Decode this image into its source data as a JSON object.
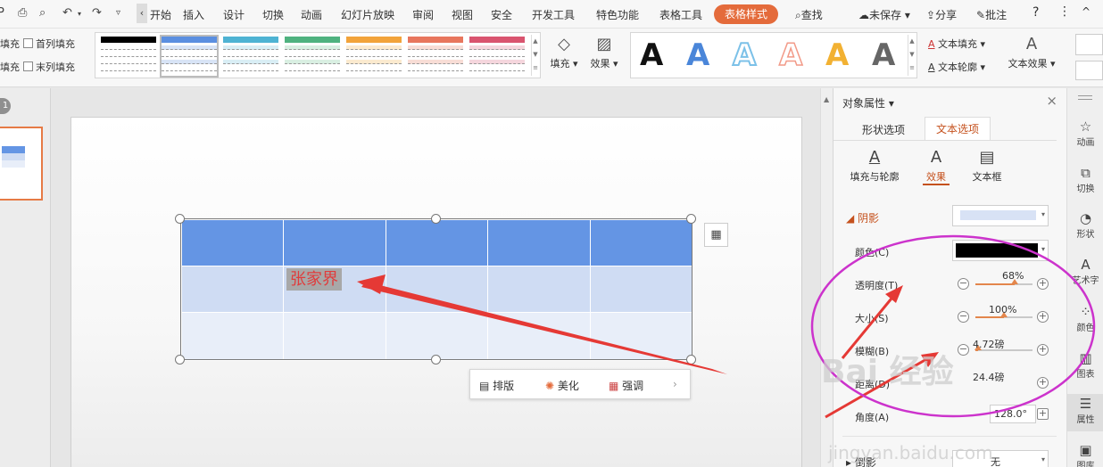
{
  "menubar": {
    "icons": [
      "print-icon",
      "print-preview-icon",
      "undo-icon",
      "redo-icon",
      "more-icon"
    ],
    "tabs": [
      "开始",
      "插入",
      "设计",
      "切换",
      "动画",
      "幻灯片放映",
      "审阅",
      "视图",
      "安全",
      "开发工具",
      "特色功能",
      "表格工具",
      "表格样式"
    ],
    "active_tab": "表格样式",
    "search": "查找",
    "unsaved": "未保存",
    "share": "分享",
    "comment": "批注",
    "help": "?",
    "ribbon_collapse": "^"
  },
  "ribbon": {
    "options": [
      "填充",
      "首列填充",
      "填充",
      "末列填充"
    ],
    "fill_label": "填充",
    "effect_label": "效果",
    "text_fill": "文本填充",
    "text_outline": "文本轮廓",
    "text_effect": "文本效果",
    "wordart_letter": "A",
    "table_style_colors": [
      "#000000",
      "#5b8fe0",
      "#4eb3d3",
      "#4fb27f",
      "#f2a33a",
      "#e8765d",
      "#d9546f"
    ],
    "wordart_colors": [
      "#111111",
      "#4a86d9",
      "#7cc1e8",
      "#f29a88",
      "#f2b132",
      "#666666"
    ]
  },
  "left_pane": {
    "slide_number": "1"
  },
  "slide": {
    "cell_text": "张家界",
    "context_bar": {
      "layout": "排版",
      "beautify": "美化",
      "emphasize": "强调"
    }
  },
  "panel": {
    "title": "对象属性",
    "tabs": [
      "形状选项",
      "文本选项"
    ],
    "active_tab": "文本选项",
    "subtabs": [
      "填充与轮廓",
      "效果",
      "文本框"
    ],
    "active_subtab": "效果",
    "shadow": {
      "section_label": "阴影",
      "color_label": "颜色(C)",
      "transparency_label": "透明度(T)",
      "transparency_value": "68%",
      "transparency_level": 0.68,
      "size_label": "大小(S)",
      "size_value": "100%",
      "size_level": 0.5,
      "blur_label": "模糊(B)",
      "blur_value": "4.72磅",
      "blur_level": 0.05,
      "distance_label": "距离(D)",
      "distance_value": "24.4磅",
      "angle_label": "角度(A)",
      "angle_value": "128.0°"
    },
    "reflection": {
      "section_label": "倒影",
      "value": "无"
    }
  },
  "sidebar": [
    "动画",
    "切换",
    "形状",
    "艺术字",
    "颜色",
    "图表",
    "属性",
    "图库"
  ],
  "sidebar_active": "属性",
  "watermark": {
    "brand": "Bai 经验",
    "url": "jingyan.baidu.com"
  },
  "colors": {
    "accent": "#e46b3b",
    "table_header": "#6495e4",
    "table_row1": "#cfdcf3",
    "table_row2": "#e8eef9",
    "annotation": "#e53935",
    "ellipse": "#cc33cc"
  }
}
